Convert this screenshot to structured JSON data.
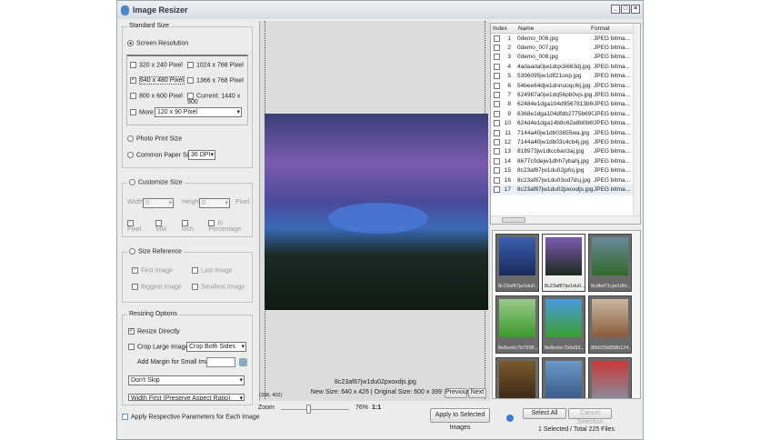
{
  "window": {
    "title": "Image Resizer"
  },
  "standard_size": {
    "legend": "Standard Size",
    "screen_resolution": "Screen Resolution",
    "options": [
      {
        "label": "320 x 240 Pixel",
        "checked": false
      },
      {
        "label": "1024 x 768 Pixel",
        "checked": false
      },
      {
        "label": "640 x 480 Pixel",
        "checked": true
      },
      {
        "label": "1366 x 768 Pixel",
        "checked": false
      },
      {
        "label": "800 x 600 Pixel",
        "checked": false
      },
      {
        "label": "Current: 1440 x 900",
        "checked": false
      }
    ],
    "more_label": "More",
    "more_value": "120 x 90 Pixel",
    "photo_print": "Photo Print Size",
    "common_paper": "Common Paper Size",
    "dpi": "36 DPI"
  },
  "customize": {
    "legend": "Customize Size",
    "width_label": "Width",
    "width_value": "0",
    "height_label": "Height",
    "height_value": "0",
    "unit": "Pixel",
    "units": [
      "Pixel",
      "MM",
      "Inch",
      "In Percentage"
    ]
  },
  "size_reference": {
    "legend": "Size Reference",
    "options": [
      "First Image",
      "Last Image",
      "Biggest Image",
      "Smallest Image"
    ]
  },
  "resizing": {
    "legend": "Resizing Options",
    "resize_directly": "Resize Directly",
    "crop_large": "Crop Large Images",
    "crop_value": "Crop Both Sides",
    "add_margin": "Add Margin for Small Images",
    "skip_value": "Don't Skip",
    "fit_value": "Width First (Preserve Aspect Ratio)"
  },
  "apply_each": "Apply Respective Parameters for Each Image",
  "preview": {
    "filename": "8c23af87jw1du02pxoxdjs.jpg",
    "size_info": "New Size: 640 x 426 | Original Size: 600 x 399",
    "coords": "(338, 402)",
    "previous": "Previous",
    "next": "Next",
    "zoom_label": "Zoom",
    "zoom_value": "76%",
    "ratio": "1:1",
    "zoom_fraction": 0.4
  },
  "apply_selected": "Apply to Selected Images",
  "file_list": {
    "columns": [
      "Index",
      "Name",
      "Format"
    ],
    "rows": [
      [
        "1",
        "0demo_006.jpg",
        "JPEG bitma..."
      ],
      [
        "2",
        "0demo_007.jpg",
        "JPEG bitma..."
      ],
      [
        "3",
        "0demo_008.jpg",
        "JPEG bitma..."
      ],
      [
        "4",
        "4adaada0jw1dqx3i663dj.jpg",
        "JPEG bitma..."
      ],
      [
        "5",
        "5396095jw1dlf21oop.jpg",
        "JPEG bitma..."
      ],
      [
        "6",
        "54bee64djw1dnnuoqc6lj.jpg",
        "JPEG bitma..."
      ],
      [
        "7",
        "624987a0jw1dq56pb0vjs.jpg",
        "JPEG bitma..."
      ],
      [
        "8",
        "62484e1dga104d9567813b690...",
        "JPEG bitma..."
      ],
      [
        "9",
        "6368e1dga104dfdb2775b690...",
        "JPEG bitma..."
      ],
      [
        "10",
        "624d4e1dga14b8c62a8b0b690...",
        "JPEG bitma..."
      ],
      [
        "11",
        "7144a40jw1db03855wa.jpg",
        "JPEG bitma..."
      ],
      [
        "12",
        "7144a40jw1db03c4cb4j.jpg",
        "JPEG bitma..."
      ],
      [
        "13",
        "818973jw1dtcc6an3aj.jpg",
        "JPEG bitma..."
      ],
      [
        "14",
        "8677c0dejw1dhh7ybahj.jpg",
        "JPEG bitma..."
      ],
      [
        "15",
        "8c23af87jw1du02jpfoj.jpg",
        "JPEG bitma..."
      ],
      [
        "16",
        "8c23af87jw1du03od7dsj.jpg",
        "JPEG bitma..."
      ],
      [
        "17",
        "8c23af87jw1du02pxoxdjs.jpg",
        "JPEG bitma..."
      ]
    ]
  },
  "thumbnails": [
    {
      "caption": "8c23af87jw1du0...",
      "c1": "#3a5fb0",
      "c2": "#1a2a5a"
    },
    {
      "caption": "8c23af87jw1du0...",
      "c1": "#7a5ab0",
      "c2": "#1e2a1e",
      "selected": true
    },
    {
      "caption": "8cdbd71cjw1dhl...",
      "c1": "#6a8a9a",
      "c2": "#2f6a2a"
    },
    {
      "caption": "8e8eebc7b7998...",
      "c1": "#9ac88a",
      "c2": "#3a9a2a"
    },
    {
      "caption": "8e8eebc7b6d93...",
      "c1": "#4a9ae0",
      "c2": "#3aa030"
    },
    {
      "caption": "8fb029b858b124...",
      "c1": "#c8b8a0",
      "c2": "#8a5a3a"
    },
    {
      "caption": "",
      "c1": "#7a5a2a",
      "c2": "#3a2a1a"
    },
    {
      "caption": "",
      "c1": "#6a9ac8",
      "c2": "#3a5a8a"
    },
    {
      "caption": "",
      "c1": "#c83a3a",
      "c2": "#8a8a9a"
    }
  ],
  "select_all": "Select All",
  "cancel_selection": "Cancel Selection",
  "status": "1 Selected / Total 225 Files"
}
